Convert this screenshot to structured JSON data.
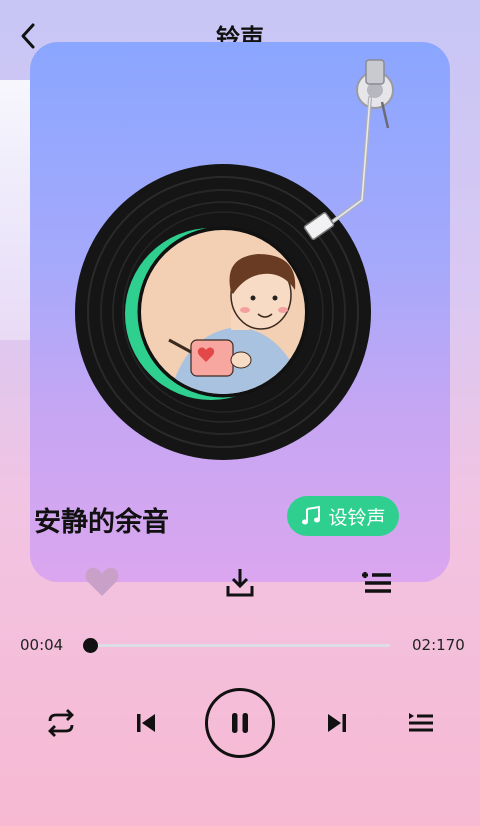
{
  "header": {
    "title": "铃声"
  },
  "song": {
    "title": "安静的余音"
  },
  "ringtone_button": {
    "label": "设铃声"
  },
  "player": {
    "current_time": "00:04",
    "total_time": "02:170",
    "progress_percent": 0,
    "is_playing": true,
    "liked": false
  },
  "colors": {
    "accent_green": "#2fd08f",
    "record_black": "#151515",
    "heart_inactive": "#c9a0c8"
  },
  "icons": {
    "back": "back-icon",
    "music": "music-note-icon",
    "like": "heart-icon",
    "download": "download-icon",
    "add_playlist": "add-to-playlist-icon",
    "repeat": "repeat-icon",
    "previous": "previous-icon",
    "pause": "pause-icon",
    "next": "next-icon",
    "playlist": "playlist-icon"
  }
}
